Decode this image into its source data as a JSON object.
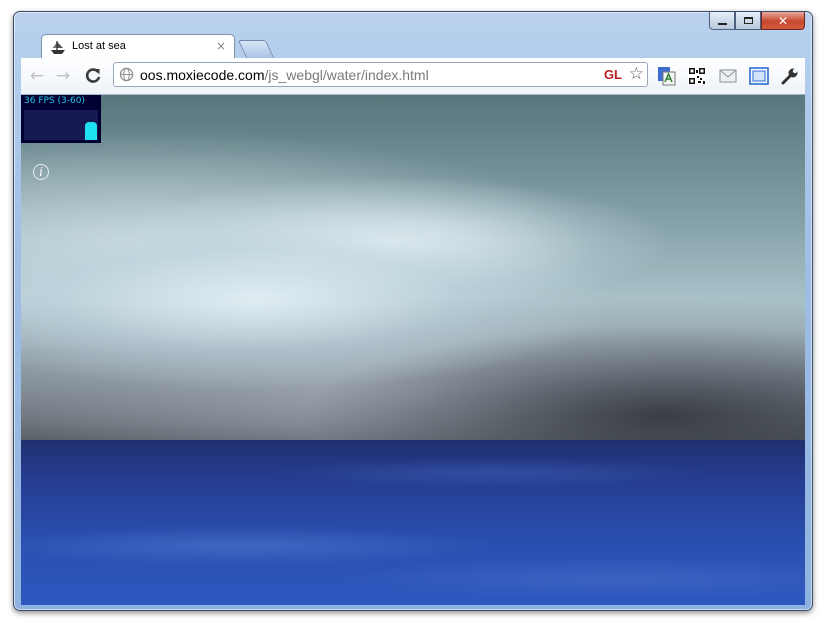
{
  "tab": {
    "title": "Lost at sea",
    "close_glyph": "×"
  },
  "toolbar": {
    "back_glyph": "←",
    "forward_glyph": "→",
    "reload_glyph": "C",
    "url_host": "oos.moxiecode.com",
    "url_path": "/js_webgl/water/index.html",
    "gl_badge": "GL",
    "star_glyph": "☆",
    "extension_icons": [
      "translate-icon",
      "qr-code-icon",
      "mail-icon",
      "fullscreen-icon",
      "wrench-icon"
    ]
  },
  "window": {
    "close_glyph": "✕"
  },
  "page": {
    "fps_label": "36 FPS (3-60)",
    "fps_fraction": 0.6,
    "info_glyph": "i"
  },
  "colors": {
    "fps_text": "#23c6e6",
    "fps_bar": "#1fe0f0",
    "gl_badge": "#b71e1e",
    "sea_blue": "#2a50b2",
    "sky_teal": "#8aa6ad"
  }
}
